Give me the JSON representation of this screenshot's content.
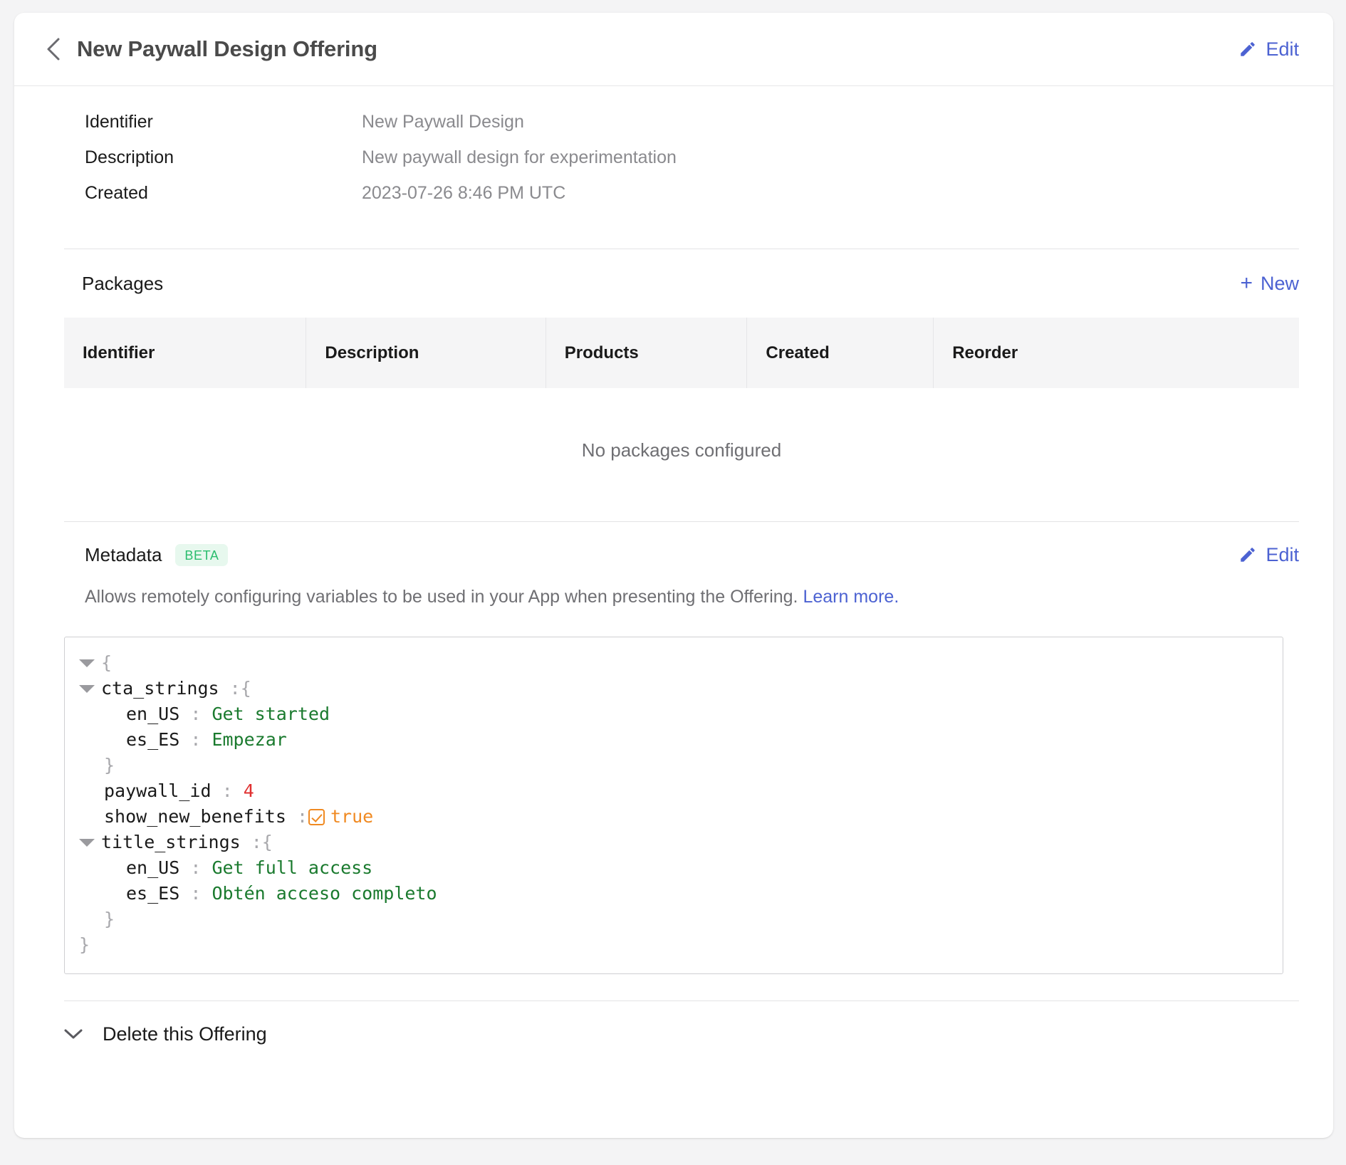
{
  "header": {
    "back_icon": "chevron-left-icon",
    "title": "New Paywall Design Offering",
    "edit_label": "Edit",
    "edit_icon": "pencil-icon"
  },
  "details": [
    {
      "label": "Identifier",
      "value": "New Paywall Design"
    },
    {
      "label": "Description",
      "value": "New paywall design for experimentation"
    },
    {
      "label": "Created",
      "value": "2023-07-26 8:46 PM UTC"
    }
  ],
  "packages": {
    "title": "Packages",
    "new_label": "New",
    "new_icon": "plus-icon",
    "columns": [
      "Identifier",
      "Description",
      "Products",
      "Created",
      "Reorder"
    ],
    "empty_message": "No packages configured",
    "rows": []
  },
  "metadata": {
    "title": "Metadata",
    "badge": "BETA",
    "edit_label": "Edit",
    "edit_icon": "pencil-icon",
    "description": "Allows remotely configuring variables to be used in your App when presenting the Offering.",
    "learn_more_label": "Learn more.",
    "json": {
      "open_brace": "{",
      "close_brace": "}",
      "lines": [
        {
          "key": "cta_strings",
          "punct": ":",
          "brace": "{"
        },
        {
          "key": "en_US",
          "punct": ":",
          "value": "Get started",
          "type": "string"
        },
        {
          "key": "es_ES",
          "punct": ":",
          "value": "Empezar",
          "type": "string"
        },
        {
          "brace": "}"
        },
        {
          "key": "paywall_id",
          "punct": ":",
          "value": "4",
          "type": "number"
        },
        {
          "key": "show_new_benefits",
          "punct": ":",
          "value": "true",
          "type": "boolean",
          "checked": true
        },
        {
          "key": "title_strings",
          "punct": ":",
          "brace": "{"
        },
        {
          "key": "en_US",
          "punct": ":",
          "value": "Get full access",
          "type": "string"
        },
        {
          "key": "es_ES",
          "punct": ":",
          "value": "Obtén acceso completo",
          "type": "string"
        },
        {
          "brace": "}"
        }
      ]
    }
  },
  "delete": {
    "label": "Delete this Offering",
    "icon": "chevron-down-icon"
  },
  "colors": {
    "link": "#4c62d2",
    "badge_bg": "#e7f8ee",
    "badge_text": "#2bbd6e",
    "json_string": "#1a7a2e",
    "json_number": "#e03030",
    "json_boolean": "#f08a22"
  }
}
